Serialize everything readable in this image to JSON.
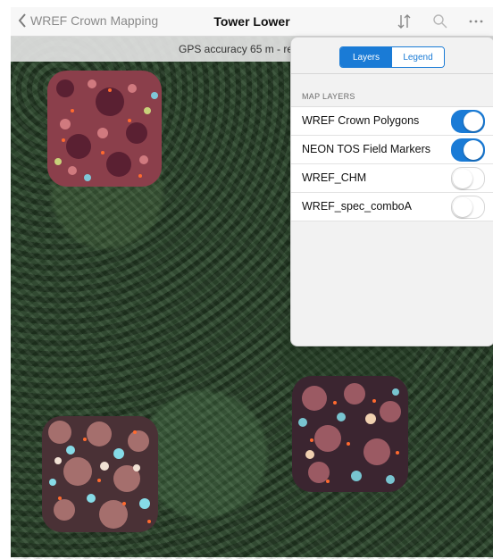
{
  "nav": {
    "back_label": "WREF Crown Mapping",
    "title": "Tower Lower",
    "icons": [
      "sort-icon",
      "search-icon",
      "more-icon"
    ]
  },
  "banner": {
    "text": "GPS accuracy 65 m - requ"
  },
  "panel": {
    "tabs": [
      {
        "label": "Layers",
        "active": true
      },
      {
        "label": "Legend",
        "active": false
      }
    ],
    "section_title": "MAP LAYERS",
    "layers": [
      {
        "label": "WREF Crown Polygons",
        "enabled": true
      },
      {
        "label": "NEON TOS Field Markers",
        "enabled": true
      },
      {
        "label": "WREF_CHM",
        "enabled": false
      },
      {
        "label": "WREF_spec_comboA",
        "enabled": false
      }
    ],
    "colors": {
      "accent": "#1a7bd6"
    }
  },
  "map": {
    "overlay_patches": [
      "imagery-patch",
      "imagery-patch",
      "imagery-patch"
    ]
  }
}
